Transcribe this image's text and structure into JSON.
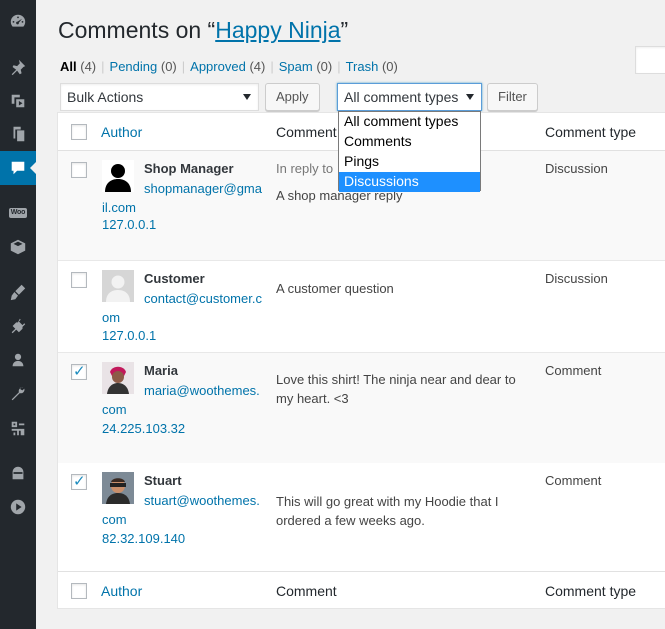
{
  "sidebar": {
    "items": [
      {
        "icon": "dashboard-icon"
      },
      {
        "icon": "pin-icon"
      },
      {
        "icon": "media-icon"
      },
      {
        "icon": "pages-icon"
      },
      {
        "icon": "comments-icon",
        "current": true
      },
      {
        "icon": "woocommerce-icon",
        "badge": "Woo"
      },
      {
        "icon": "products-icon"
      },
      {
        "icon": "appearance-icon"
      },
      {
        "icon": "plugins-icon"
      },
      {
        "icon": "users-icon"
      },
      {
        "icon": "tools-icon"
      },
      {
        "icon": "settings-icon"
      },
      {
        "icon": "ninja-icon"
      },
      {
        "icon": "play-icon"
      }
    ]
  },
  "page": {
    "title_prefix": "Comments on “",
    "title_link": "Happy Ninja",
    "title_suffix": "”"
  },
  "status_links": [
    {
      "label": "All",
      "count": "(4)"
    },
    {
      "label": "Pending",
      "count": "(0)"
    },
    {
      "label": "Approved",
      "count": "(4)"
    },
    {
      "label": "Spam",
      "count": "(0)"
    },
    {
      "label": "Trash",
      "count": "(0)"
    }
  ],
  "tablenav": {
    "bulk_actions": "Bulk Actions",
    "apply": "Apply",
    "comment_types_selected": "All comment types",
    "filter": "Filter"
  },
  "dropdown": {
    "options": [
      "All comment types",
      "Comments",
      "Pings",
      "Discussions"
    ],
    "highlighted_index": 3
  },
  "table": {
    "columns": {
      "author": "Author",
      "comment": "Comment",
      "comment_type": "Comment type"
    },
    "rows": [
      {
        "name": "Shop Manager",
        "email": "shopmanager@gmail.com",
        "ip": "127.0.0.1",
        "in_reply_to": "In reply to",
        "comment": "A shop manager reply",
        "type": "Discussion",
        "checked": false
      },
      {
        "name": "Customer",
        "email": "contact@customer.com",
        "ip": "127.0.0.1",
        "comment": "A customer question",
        "type": "Discussion",
        "checked": false
      },
      {
        "name": "Maria",
        "email": "maria@woothemes.com",
        "ip": "24.225.103.32",
        "comment": "Love this shirt! The ninja near and dear to my heart. <3",
        "type": "Comment",
        "checked": true
      },
      {
        "name": "Stuart",
        "email": "stuart@woothemes.com",
        "ip": "82.32.109.140",
        "comment": "This will go great with my Hoodie that I ordered a few weeks ago.",
        "type": "Comment",
        "checked": true
      }
    ]
  },
  "colors": {
    "link": "#0073aa",
    "sidebar_bg": "#23282d",
    "sidebar_current": "#0073aa",
    "dropdown_highlight": "#1e90ff"
  }
}
